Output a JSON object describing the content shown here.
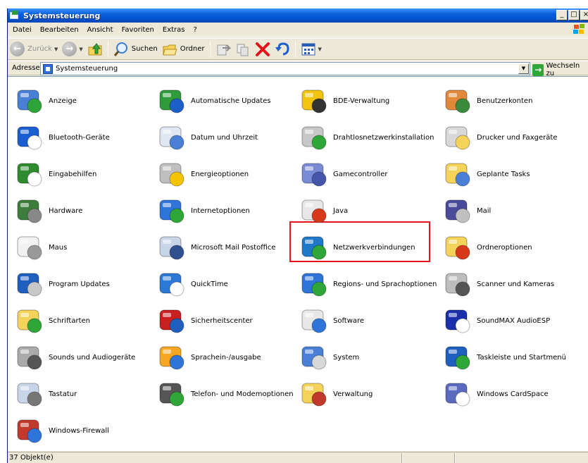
{
  "window": {
    "title": "Systemsteuerung",
    "minimize": "_",
    "maximize": "□",
    "close": "×"
  },
  "menu": [
    "Datei",
    "Bearbeiten",
    "Ansicht",
    "Favoriten",
    "Extras",
    "?"
  ],
  "toolbar": {
    "back": "Zurück",
    "search": "Suchen",
    "folders": "Ordner"
  },
  "address": {
    "label": "Adresse",
    "value": "Systemsteuerung",
    "go": "Wechseln zu"
  },
  "items": [
    "Anzeige",
    "Automatische Updates",
    "BDE-Verwaltung",
    "Benutzerkonten",
    "Bluetooth-Geräte",
    "Datum und Uhrzeit",
    "Drahtlosnetzwerkinstallation",
    "Drucker und Faxgeräte",
    "Eingabehilfen",
    "Energieoptionen",
    "Gamecontroller",
    "Geplante Tasks",
    "Hardware",
    "Internetoptionen",
    "Java",
    "Mail",
    "Maus",
    "Microsoft Mail Postoffice",
    "Netzwerkverbindungen",
    "Ordneroptionen",
    "Program Updates",
    "QuickTime",
    "Regions- und Sprachoptionen",
    "Scanner und Kameras",
    "Schriftarten",
    "Sicherheitscenter",
    "Software",
    "SoundMAX AudioESP",
    "Sounds und Audiogeräte",
    "Sprachein-/ausgabe",
    "System",
    "Taskleiste und Startmenü",
    "Tastatur",
    "Telefon- und Modemoptionen",
    "Verwaltung",
    "Windows CardSpace",
    "Windows-Firewall"
  ],
  "status": {
    "count": "37 Objekt(e)"
  },
  "colors": {
    "highlight": "#e3121b",
    "titlebar": "#0554d1"
  }
}
